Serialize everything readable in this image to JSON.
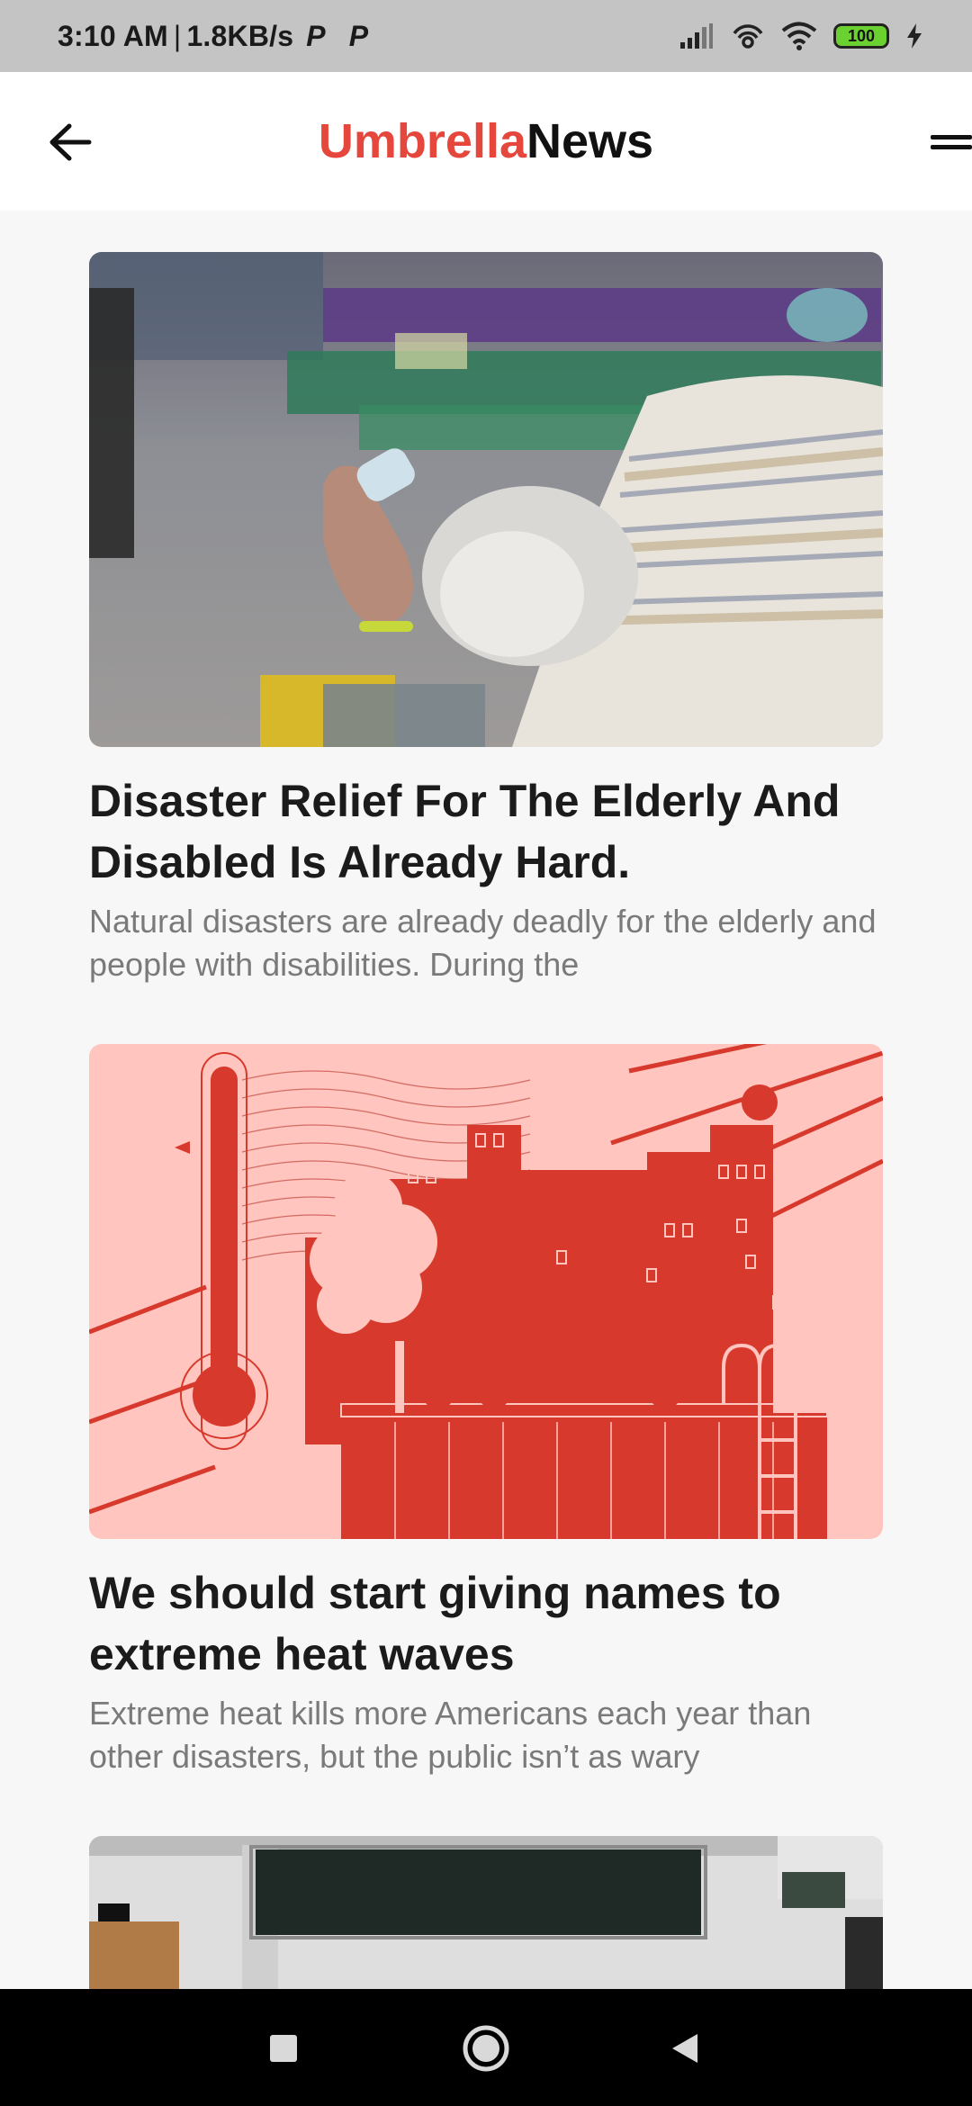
{
  "status_bar": {
    "time": "3:10 AM",
    "separator": "|",
    "net_speed": "1.8KB/s",
    "battery": "100",
    "icons": [
      "p-icon",
      "p-icon",
      "signal-icon",
      "hotspot-icon",
      "wifi-icon",
      "battery-icon",
      "charging-icon"
    ]
  },
  "header": {
    "brand_part1": "Umbrella",
    "brand_part2": "News",
    "brand_color": "#e5473d",
    "icons": [
      "back-arrow-icon",
      "menu-icon"
    ]
  },
  "articles": [
    {
      "title": "Disaster Relief For The Elderly And Disabled Is Already Hard.",
      "summary": "Natural disasters are already deadly for the elderly and people with disabilities. During the"
    },
    {
      "title": "We should start giving names to extreme heat waves",
      "summary": "Extreme heat kills more Americans each year than other disasters, but the public isn’t as wary"
    }
  ],
  "nav_bar": {
    "icons": [
      "recents-square-icon",
      "home-circle-icon",
      "back-triangle-icon"
    ]
  }
}
